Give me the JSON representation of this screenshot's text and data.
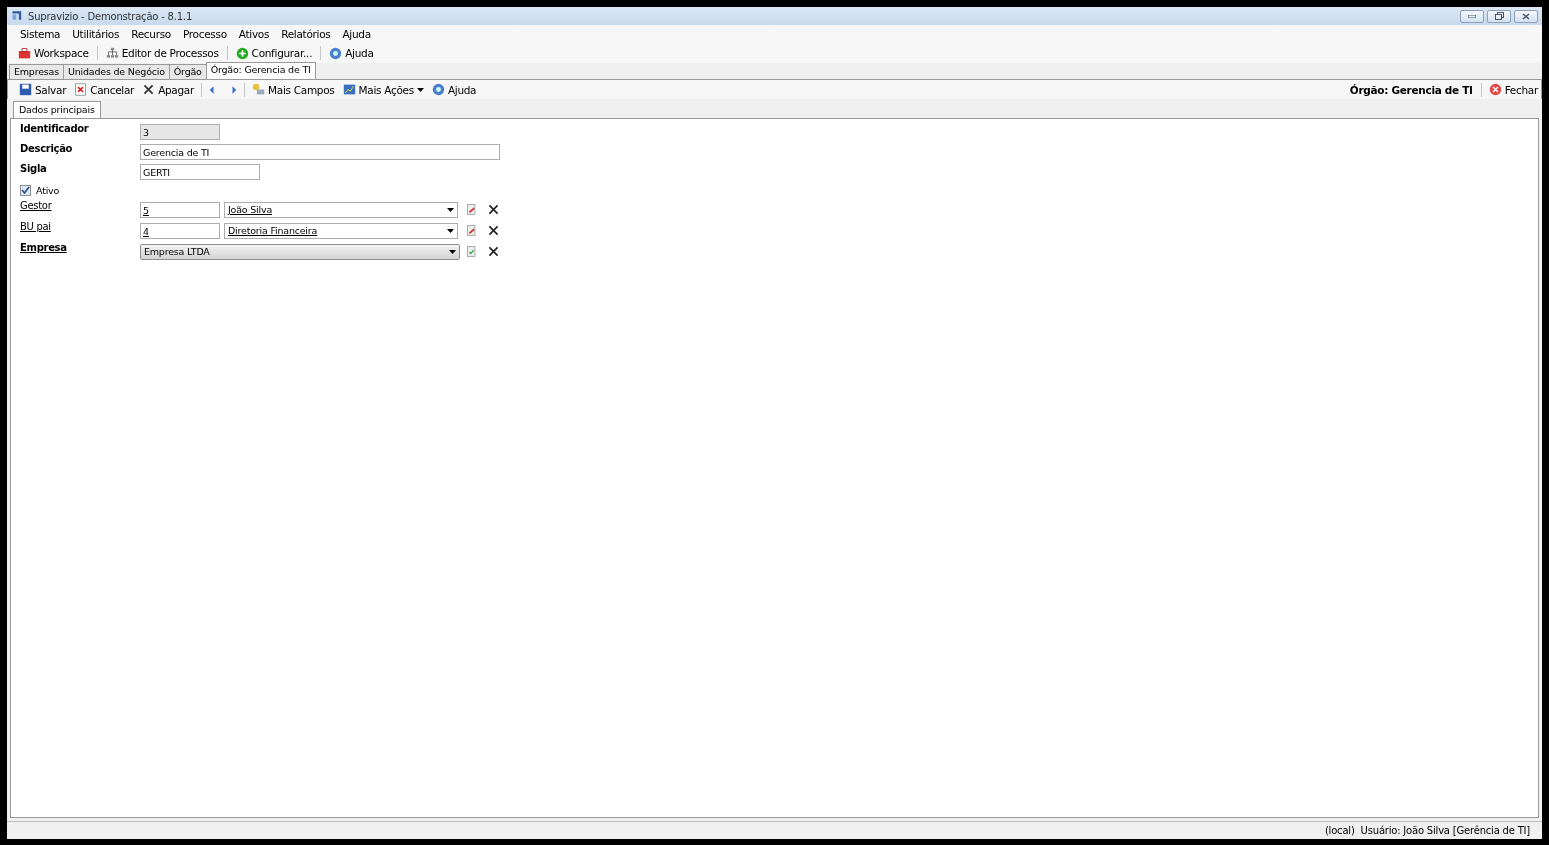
{
  "window": {
    "title": "Supravizio - Demonstração - 8.1.1"
  },
  "menu": [
    "Sistema",
    "Utilitários",
    "Recurso",
    "Processo",
    "Ativos",
    "Relatórios",
    "Ajuda"
  ],
  "toolbar": [
    "Workspace",
    "Editor de Processos",
    "Configurar...",
    "Ajuda"
  ],
  "tabs": [
    {
      "label": "Empresas",
      "selected": false
    },
    {
      "label": "Unidades de Negócio",
      "selected": false
    },
    {
      "label": "Órgão",
      "selected": false
    },
    {
      "label": "Órgão: Gerencia de TI",
      "selected": true
    }
  ],
  "form_toolbar": {
    "actions": [
      "Salvar",
      "Cancelar",
      "Apagar"
    ],
    "extra": [
      "Mais Campos",
      "Mais Ações",
      "Ajuda"
    ],
    "title": "Órgão: Gerencia de TI",
    "close": "Fechar"
  },
  "inner_tabs": [
    {
      "label": "Dados principais",
      "selected": true
    }
  ],
  "fields": [
    {
      "kind": "readonly",
      "label": "Identificador",
      "bold": true,
      "link": false,
      "value": "3"
    },
    {
      "kind": "text",
      "label": "Descrição",
      "bold": true,
      "link": false,
      "value": "Gerencia de TI",
      "wide": true
    },
    {
      "kind": "text",
      "label": "Sigla",
      "bold": true,
      "link": false,
      "value": "GERTI",
      "wide": false
    },
    {
      "kind": "checkbox",
      "label": "Ativo",
      "checked": true
    },
    {
      "kind": "lookup",
      "label": "Gestor",
      "bold": false,
      "link": true,
      "code": "5",
      "value": "João Silva"
    },
    {
      "kind": "lookup",
      "label": "BU pai",
      "bold": false,
      "link": true,
      "code": "4",
      "value": "Diretoria Financeira"
    },
    {
      "kind": "combo",
      "label": "Empresa",
      "bold": true,
      "link": true,
      "value": "Empresa LTDA"
    }
  ],
  "status_bar": [
    "(local)",
    "Usuário: João Silva [Gerência de TI]"
  ]
}
